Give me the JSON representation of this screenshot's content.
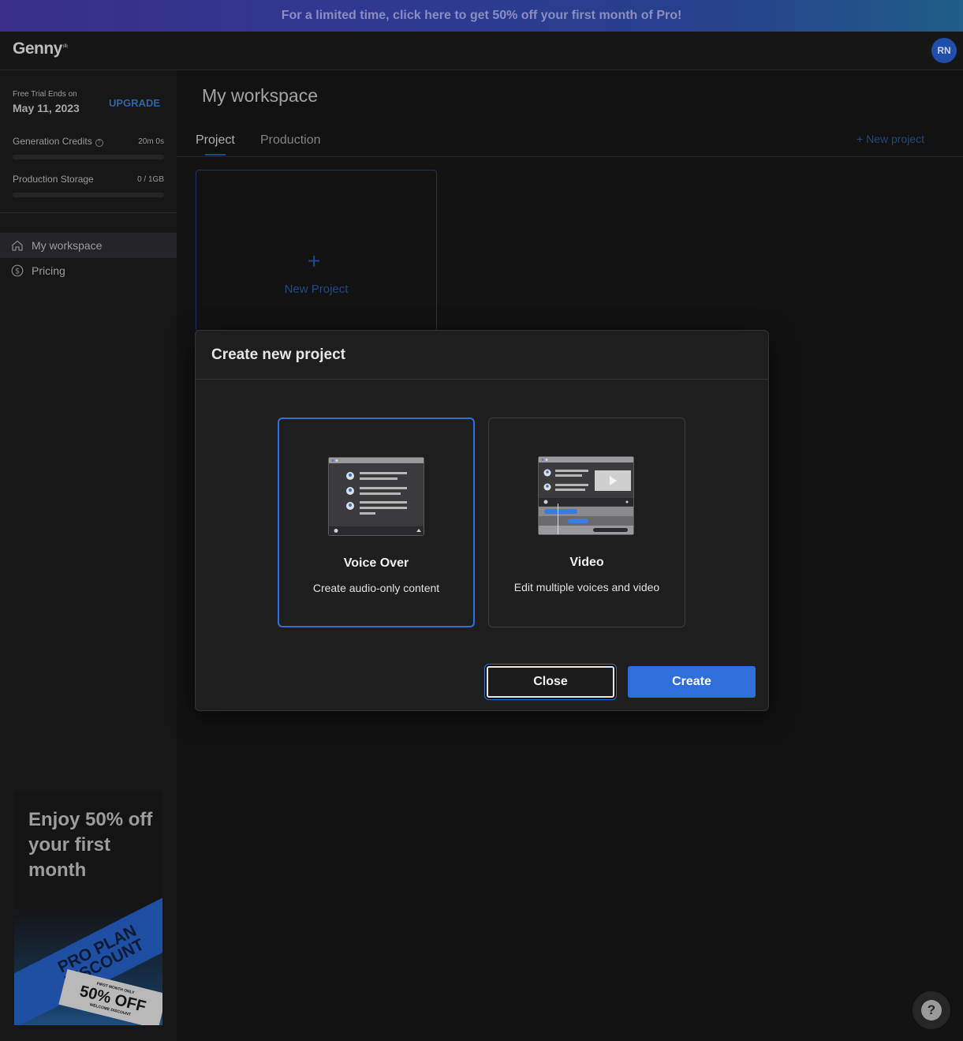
{
  "promo": {
    "text": "For a limited time, click here to get 50% off your first month of Pro!"
  },
  "app": {
    "logo": "Genny",
    "logo_mark": "ᵎᴵᴵᵎ"
  },
  "user": {
    "initials": "RN"
  },
  "sidebar": {
    "trial_label": "Free Trial Ends on",
    "trial_date": "May 11, 2023",
    "upgrade_label": "UPGRADE",
    "credits_label": "Generation Credits",
    "credits_info": "?",
    "credits_value": "20m 0s",
    "storage_label": "Production Storage",
    "storage_value": "0 / 1GB",
    "items": [
      {
        "label": "My workspace",
        "icon": "home-icon",
        "active": true
      },
      {
        "label": "Pricing",
        "icon": "dollar-icon",
        "active": false
      }
    ]
  },
  "ad": {
    "headline": "Enjoy 50% off your first month",
    "ribbon_line1": "PRO PLAN",
    "ribbon_line2": "DISCOUNT",
    "ticket_top": "FIRST MONTH ONLY",
    "ticket_main": "50% OFF",
    "ticket_bottom": "WELCOME DISCOUNT"
  },
  "main": {
    "title": "My workspace",
    "tabs": [
      {
        "label": "Project",
        "active": true
      },
      {
        "label": "Production",
        "active": false
      }
    ],
    "new_project_link": "+ New project",
    "new_project_card": {
      "plus": "+",
      "label": "New Project"
    }
  },
  "modal": {
    "title": "Create new project",
    "options": [
      {
        "title": "Voice Over",
        "description": "Create audio-only content",
        "selected": true,
        "icon": "voice-over-illustration"
      },
      {
        "title": "Video",
        "description": "Edit multiple voices and video",
        "selected": false,
        "icon": "video-illustration"
      }
    ],
    "close_label": "Close",
    "create_label": "Create"
  },
  "help": {
    "label": "?"
  },
  "colors": {
    "accent": "#2f6fdc",
    "background": "#121212",
    "modal_bg": "#1e1e1f",
    "promo_start": "#3a2f8a",
    "promo_end": "#1f5e88"
  }
}
